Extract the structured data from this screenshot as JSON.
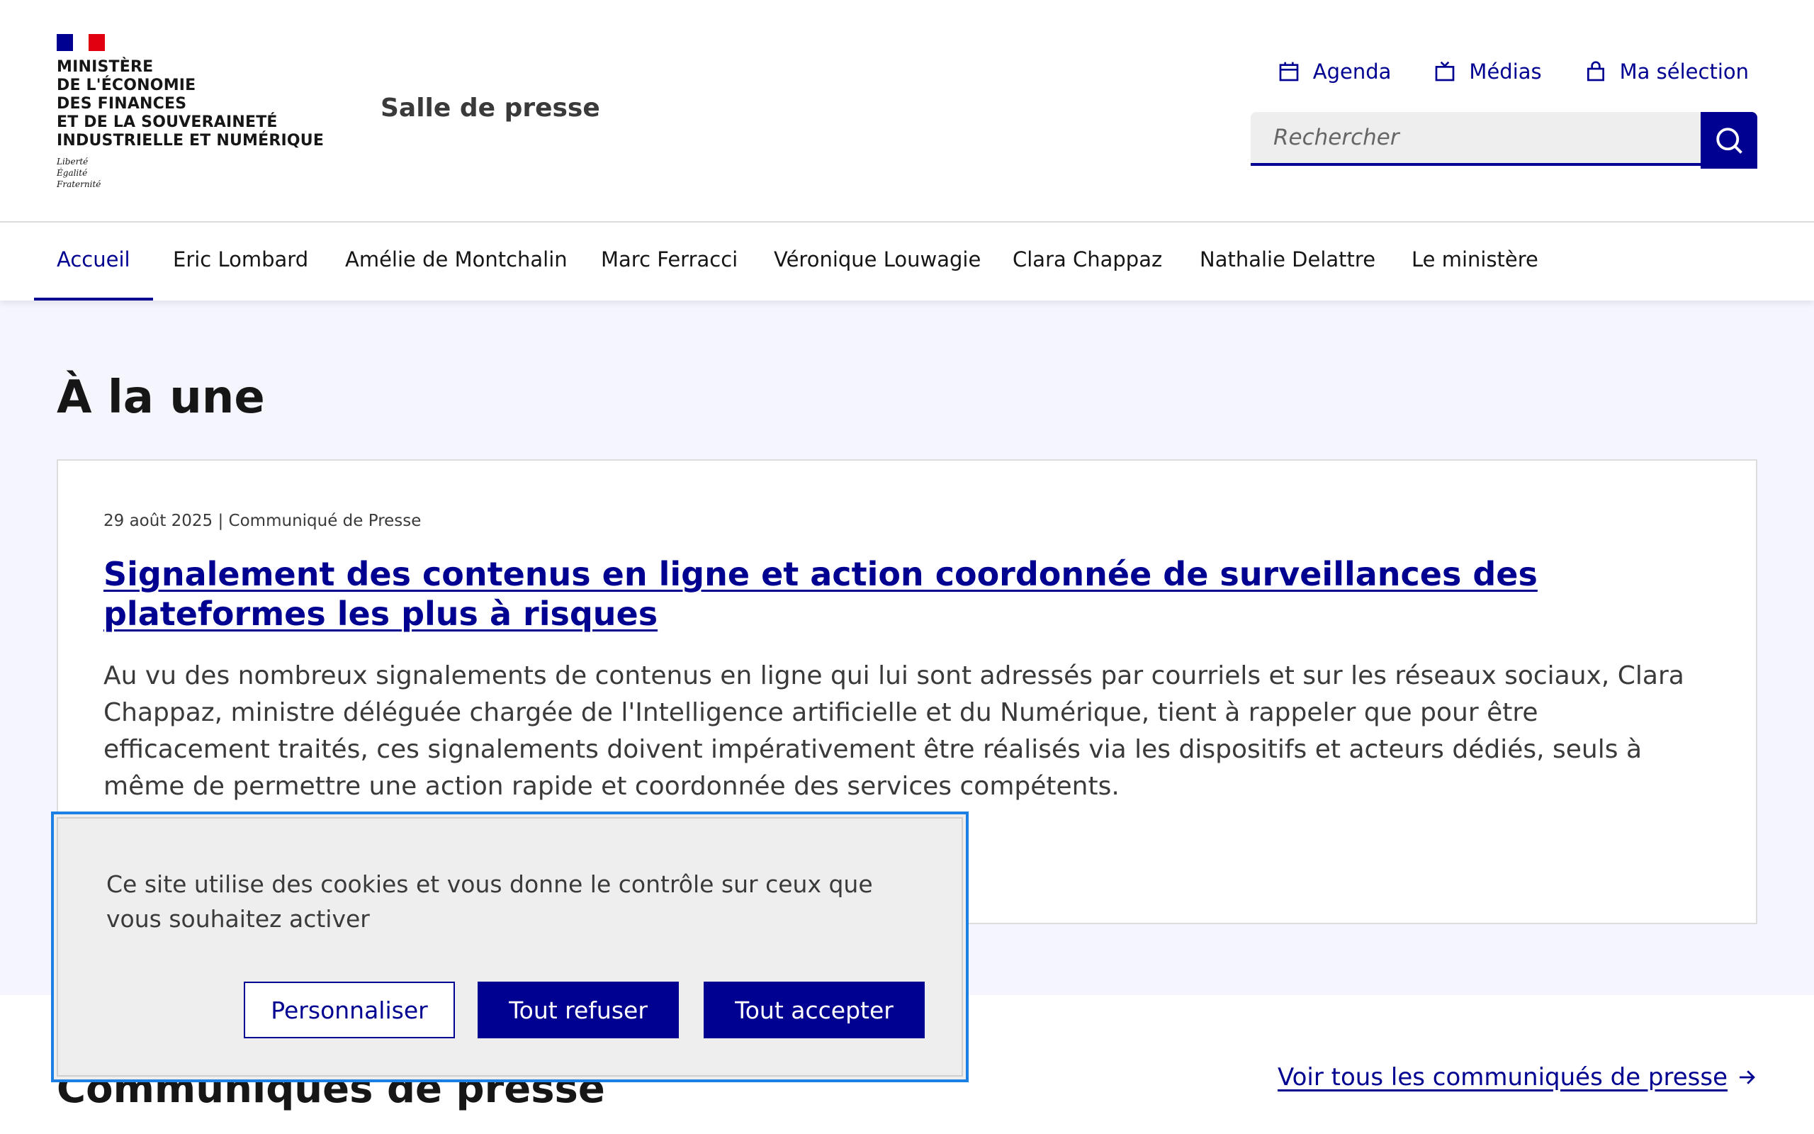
{
  "header": {
    "logo": {
      "lines": [
        "MINISTÈRE",
        "DE L'ÉCONOMIE",
        "DES FINANCES",
        "ET DE LA SOUVERAINETÉ",
        "INDUSTRIELLE ET NUMÉRIQUE"
      ],
      "motto": [
        "Liberté",
        "Égalité",
        "Fraternité"
      ]
    },
    "site_title": "Salle de presse",
    "tools": [
      {
        "label": "Agenda",
        "icon": "calendar-icon"
      },
      {
        "label": "Médias",
        "icon": "media-icon"
      },
      {
        "label": "Ma sélection",
        "icon": "bag-icon"
      }
    ],
    "search": {
      "placeholder": "Rechercher",
      "button_icon": "search-icon"
    }
  },
  "nav": {
    "items": [
      "Accueil",
      "Eric Lombard",
      "Amélie de Montchalin",
      "Marc Ferracci",
      "Véronique Louwagie",
      "Clara Chappaz",
      "Nathalie Delattre",
      "Le ministère"
    ],
    "active": "Accueil"
  },
  "main": {
    "section_title": "À la une",
    "featured": {
      "meta": "29 août 2025 | Communiqué de Presse",
      "title": "Signalement des contenus en ligne et action coordonnée de surveillances des plateformes les plus à risques",
      "description": "Au vu des nombreux signalements de contenus en ligne qui lui sont adressés par courriels et sur les réseaux sociaux, Clara Chappaz, ministre déléguée chargée de l'Intelligence artificielle et du Numérique, tient à rappeler que pour être efficacement traités, ces signalements doivent impérativement être réalisés via les dispositifs et acteurs dédiés, seuls à même de permettre une action rapide et coordonnée des services compétents."
    }
  },
  "press_releases": {
    "title": "Communiqués de presse",
    "see_all": "Voir tous les communiqués de presse"
  },
  "cookie_banner": {
    "text": "Ce site utilise des cookies et vous donne le contrôle sur ceux que vous souhaitez activer",
    "buttons": {
      "customize": "Personnaliser",
      "refuse": "Tout refuser",
      "accept": "Tout accepter"
    }
  },
  "colors": {
    "primary": "#000091",
    "red": "#e1000f",
    "background_alt": "#f5f5fe",
    "focus": "#1b7fe3"
  }
}
